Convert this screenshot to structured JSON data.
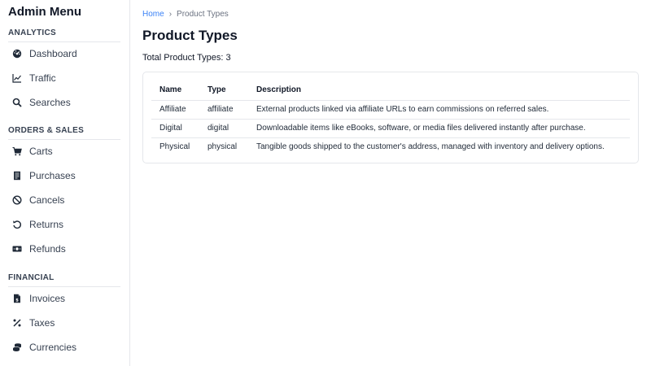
{
  "sidebar": {
    "title": "Admin Menu",
    "sections": [
      {
        "heading": "ANALYTICS",
        "items": [
          {
            "label": "Dashboard",
            "icon": "dashboard-icon"
          },
          {
            "label": "Traffic",
            "icon": "line-chart-icon"
          },
          {
            "label": "Searches",
            "icon": "search-icon"
          }
        ]
      },
      {
        "heading": "ORDERS & SALES",
        "items": [
          {
            "label": "Carts",
            "icon": "cart-icon"
          },
          {
            "label": "Purchases",
            "icon": "receipt-icon"
          },
          {
            "label": "Cancels",
            "icon": "cancel-icon"
          },
          {
            "label": "Returns",
            "icon": "undo-icon"
          },
          {
            "label": "Refunds",
            "icon": "money-icon"
          }
        ]
      },
      {
        "heading": "FINANCIAL",
        "items": [
          {
            "label": "Invoices",
            "icon": "invoice-icon"
          },
          {
            "label": "Taxes",
            "icon": "percent-icon"
          },
          {
            "label": "Currencies",
            "icon": "coins-icon"
          }
        ]
      }
    ]
  },
  "breadcrumb": {
    "home": "Home",
    "separator": "›",
    "current": "Product Types"
  },
  "page": {
    "title": "Product Types",
    "total_label": "Total Product Types: 3"
  },
  "table": {
    "headers": [
      "Name",
      "Type",
      "Description"
    ],
    "rows": [
      {
        "name": "Affiliate",
        "type": "affiliate",
        "description": "External products linked via affiliate URLs to earn commissions on referred sales."
      },
      {
        "name": "Digital",
        "type": "digital",
        "description": "Downloadable items like eBooks, software, or media files delivered instantly after purchase."
      },
      {
        "name": "Physical",
        "type": "physical",
        "description": "Tangible goods shipped to the customer's address, managed with inventory and delivery options."
      }
    ]
  },
  "colors": {
    "link": "#3b82f6",
    "border": "#e5e7eb",
    "text": "#1f2937"
  }
}
